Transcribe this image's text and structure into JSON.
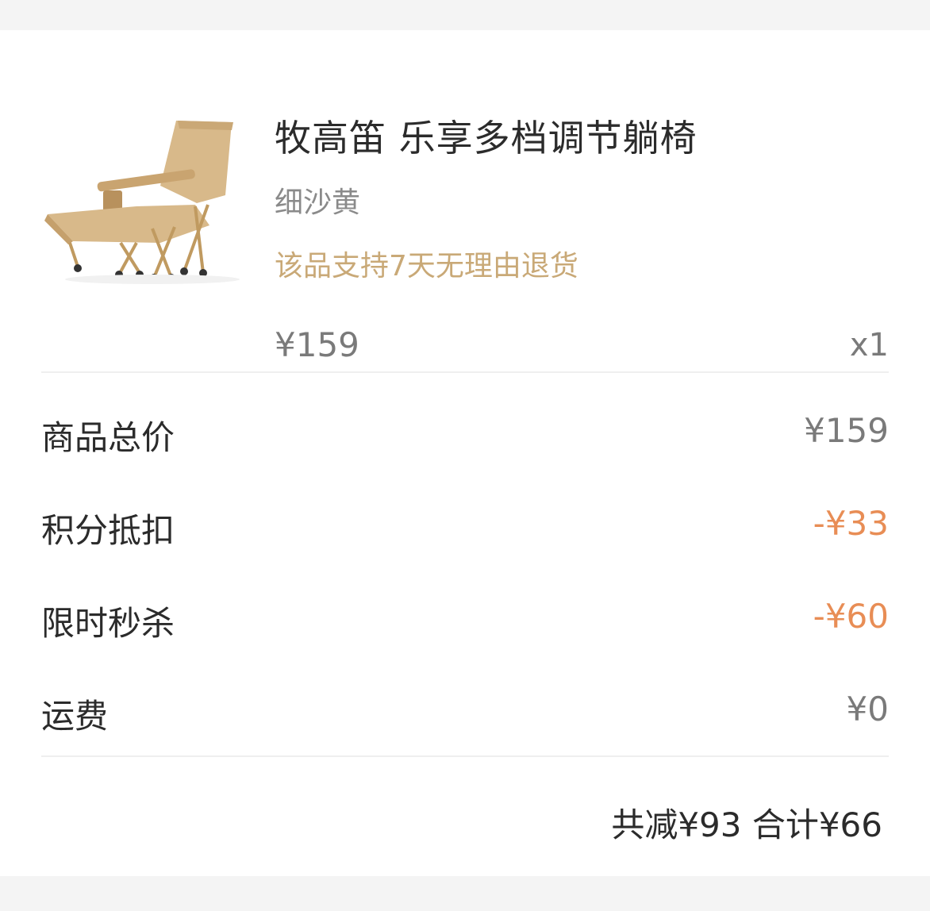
{
  "product": {
    "title": "牧高笛 乐享多档调节躺椅",
    "variant": "细沙黄",
    "return_policy": "该品支持7天无理由退货",
    "unit_price": "¥159",
    "quantity": "x1",
    "image": "folding-recliner-chair-image",
    "color": "#d8b98a"
  },
  "cost_breakdown": [
    {
      "label": "商品总价",
      "value": "¥159",
      "type": "normal"
    },
    {
      "label": "积分抵扣",
      "value": "-¥33",
      "type": "discount"
    },
    {
      "label": "限时秒杀",
      "value": "-¥60",
      "type": "discount"
    },
    {
      "label": "运费",
      "value": "¥0",
      "type": "normal"
    }
  ],
  "summary": {
    "text": "共减¥93 合计¥66"
  },
  "colors": {
    "policy": "#c9a977",
    "discount": "#e88d55",
    "text": "#2b2b2b",
    "muted": "#7a7a7a"
  }
}
